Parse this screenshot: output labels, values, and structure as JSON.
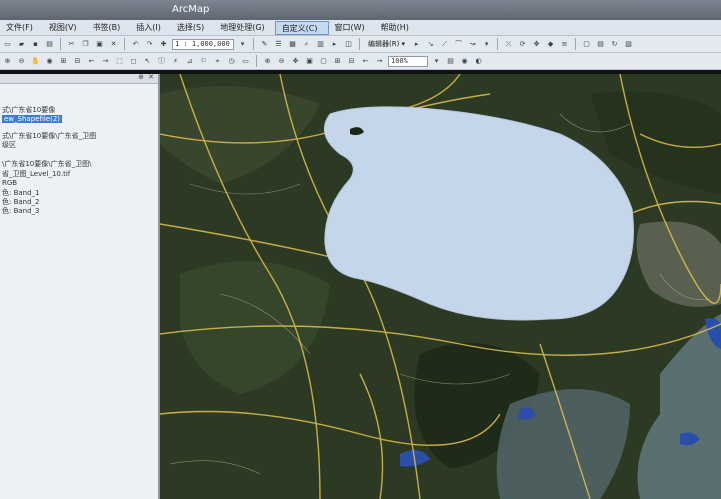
{
  "app": {
    "title": "ArcMap"
  },
  "menu": [
    {
      "label": "文件(F)"
    },
    {
      "label": "视图(V)"
    },
    {
      "label": "书签(B)"
    },
    {
      "label": "插入(I)"
    },
    {
      "label": "选择(S)"
    },
    {
      "label": "地理处理(G)"
    },
    {
      "label": "自定义(C)"
    },
    {
      "label": "窗口(W)"
    },
    {
      "label": "帮助(H)"
    }
  ],
  "toolbar": {
    "scale_value": "1 : 1,000,000",
    "editor_label": "编辑器(R) ▾",
    "zoom_value": "100%"
  },
  "toc": {
    "items": [
      {
        "label": "式\\广东省10要像"
      },
      {
        "label": "ew_Shapefile(2)"
      },
      {
        "label": "式\\广东省10要像\\广东省_卫图"
      },
      {
        "label": "级区"
      },
      {
        "label": "\\广东省10要像\\广东省_卫图\\"
      },
      {
        "label": "省_卫图_Level_10.tif"
      },
      {
        "label": "RGB"
      },
      {
        "label": "色:  Band_1"
      },
      {
        "label": "色:  Band_2"
      },
      {
        "label": "色:  Band_3"
      }
    ]
  },
  "map": {
    "colors": {
      "terrain": "#2c3a24",
      "polygon": "#c6d6ea",
      "road": "#e2c24d",
      "water": "#2a4fa8",
      "sea": "#5a6f70"
    }
  }
}
